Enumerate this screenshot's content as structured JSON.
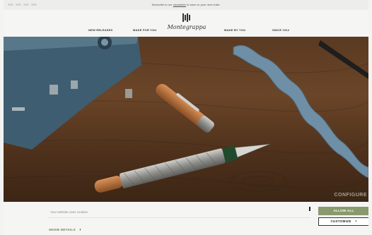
{
  "announcement": {
    "prefix": "Subscribe to our",
    "link": "newsletter",
    "suffix": "to save on your next order."
  },
  "header": {
    "logo": "Montegrappa",
    "nav": [
      "NEW RELEASES",
      "MADE FOR YOU",
      "MADE BY YOU",
      "SINCE 1912"
    ]
  },
  "hero": {
    "caption": "CONFIGURE",
    "colors": {
      "wood": "#6b4528",
      "pen_barrel": "#8e8e8a",
      "pen_wood": "#b8703c",
      "tape": "#6f8fa6",
      "machine": "#3f5d70"
    }
  },
  "cookie": {
    "text": "Your website uses cookies",
    "allow_label": "ALLOW ALL",
    "customize_label": "CUSTOMIZE",
    "details_label": "SHOW DETAILS",
    "accent": "#8a9a6c"
  }
}
